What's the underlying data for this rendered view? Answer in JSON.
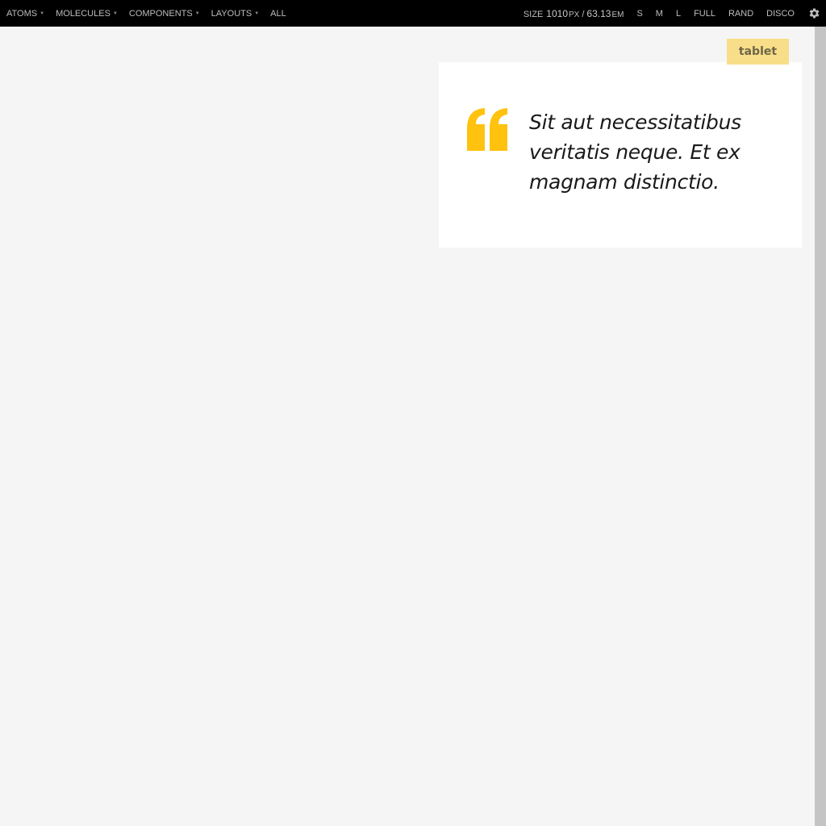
{
  "nav": {
    "items": [
      {
        "label": "ATOMS",
        "has_dropdown": true
      },
      {
        "label": "MOLECULES",
        "has_dropdown": true
      },
      {
        "label": "COMPONENTS",
        "has_dropdown": true
      },
      {
        "label": "LAYOUTS",
        "has_dropdown": true
      },
      {
        "label": "ALL",
        "has_dropdown": false
      }
    ],
    "caret": "▼"
  },
  "size": {
    "label": "SIZE",
    "px_value": "1010",
    "px_unit": "PX",
    "separator": "/",
    "em_value": "63.13",
    "em_unit": "EM"
  },
  "size_buttons": [
    "S",
    "M",
    "L",
    "FULL",
    "RAND",
    "DISCO"
  ],
  "settings_icon": "gear-icon",
  "badge": {
    "label": "tablet"
  },
  "quote": {
    "text": "Sit aut necessitatibus veritatis neque. Et ex magnam distinctio."
  },
  "colors": {
    "topbar_bg": "#000000",
    "topbar_text": "#bdbdbd",
    "page_bg": "#f5f5f5",
    "accent_yellow": "#ffc20e",
    "badge_bg": "#f8de88",
    "scrollbar": "#c4c4c4"
  }
}
